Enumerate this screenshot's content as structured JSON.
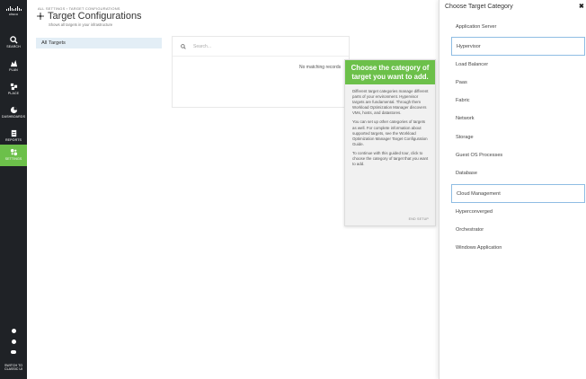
{
  "nav": {
    "logo_text": "cisco",
    "items": [
      {
        "label": "SEARCH",
        "icon": "search-icon"
      },
      {
        "label": "PLAN",
        "icon": "plan-icon"
      },
      {
        "label": "PLACE",
        "icon": "place-icon"
      },
      {
        "label": "DASHBOARDS",
        "icon": "dashboard-icon"
      },
      {
        "label": "REPORTS",
        "icon": "reports-icon"
      },
      {
        "label": "SETTINGS",
        "icon": "settings-icon",
        "active": true
      }
    ],
    "bottom_icons": [
      "info-icon",
      "help-icon",
      "toggle-icon"
    ],
    "switch_label_line1": "SWITCH TO",
    "switch_label_line2": "CLASSIC UI"
  },
  "header": {
    "breadcrumb": "ALL SETTINGS › TARGET CONFIGURATIONS",
    "title": "Target Configurations",
    "subtitle": "Shows all targets in your infrastructure"
  },
  "sidebar": {
    "all_targets_label": "All Targets"
  },
  "main": {
    "search_placeholder": "Search...",
    "no_match_text": "No matching records"
  },
  "tour": {
    "heading": "Choose the category of target you want to add.",
    "paragraphs": [
      "Different target categories manage different parts of your environment. Hypervisor targets are fundamental. Through them Workload Optimization Manager discovers VMs, hosts, and datastores.",
      "You can set up other categories of targets as well. For complete information about supported targets, see the Workload Optimization Manager Target Configuration Guide.",
      "To continue with this guided tour, click to choose the category of target that you want to add."
    ],
    "end_label": "END SETUP"
  },
  "panel": {
    "title": "Choose Target Category",
    "categories": [
      {
        "label": "Application Server",
        "outlined": false
      },
      {
        "label": "Hypervisor",
        "outlined": true
      },
      {
        "label": "Load Balancer",
        "outlined": false
      },
      {
        "label": "Paas",
        "outlined": false
      },
      {
        "label": "Fabric",
        "outlined": false
      },
      {
        "label": "Network",
        "outlined": false
      },
      {
        "label": "Storage",
        "outlined": false
      },
      {
        "label": "Guest OS Processes",
        "outlined": false
      },
      {
        "label": "Database",
        "outlined": false
      },
      {
        "label": "Cloud Management",
        "outlined": true
      },
      {
        "label": "Hyperconverged",
        "outlined": false
      },
      {
        "label": "Orchestrator",
        "outlined": false
      },
      {
        "label": "Windows Application",
        "outlined": false
      }
    ]
  },
  "colors": {
    "accent_green": "#6cc04a",
    "nav_bg": "#1f2226",
    "selected_bg": "#e3eef6",
    "outline_blue": "#8fbde3"
  }
}
